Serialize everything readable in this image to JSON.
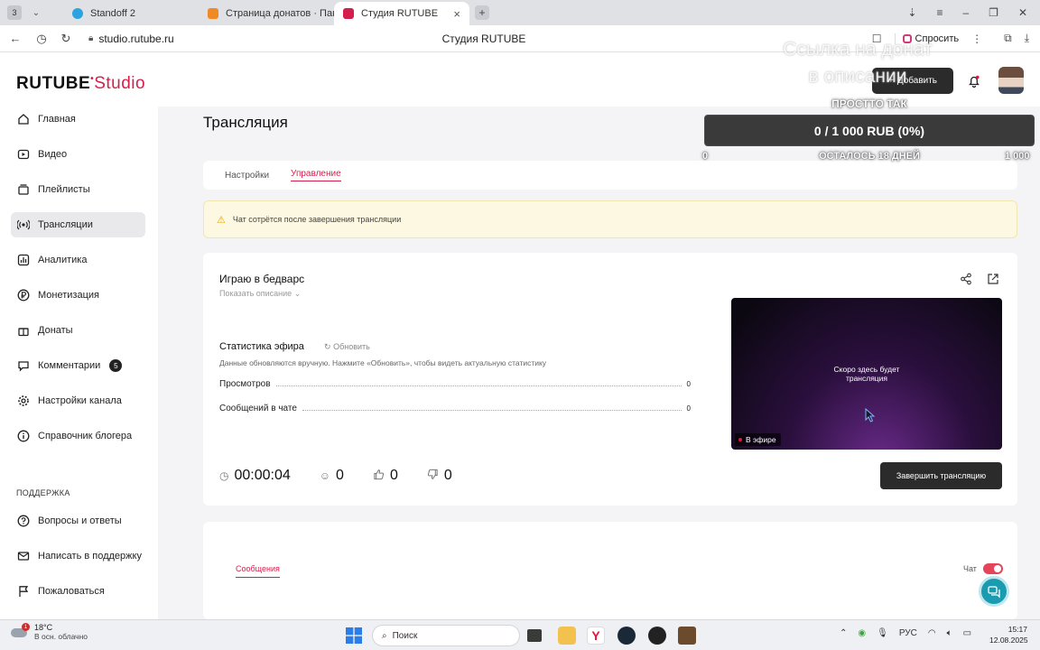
{
  "browser": {
    "tab_count": "3",
    "tabs": [
      {
        "label": "Standoff 2",
        "favicon_color": "#2aa3e0",
        "active": false
      },
      {
        "label": "Страница донатов · Панель",
        "favicon_color": "#f08a24",
        "active": false
      },
      {
        "label": "Студия RUTUBE",
        "favicon_color": "#d41f4c",
        "active": true
      }
    ],
    "url": "studio.rutube.ru",
    "page_title": "Студия RUTUBE",
    "ask_label": "Спросить"
  },
  "app": {
    "logo_brand": "RUTUBE",
    "logo_product": "Studio",
    "add_label": "Добавить",
    "menu": [
      {
        "label": "Главная",
        "icon": "home-icon"
      },
      {
        "label": "Видео",
        "icon": "video-icon"
      },
      {
        "label": "Плейлисты",
        "icon": "playlist-icon"
      },
      {
        "label": "Трансляции",
        "icon": "broadcast-icon",
        "active": true
      },
      {
        "label": "Аналитика",
        "icon": "analytics-icon"
      },
      {
        "label": "Монетизация",
        "icon": "ruble-icon"
      },
      {
        "label": "Донаты",
        "icon": "donate-icon"
      },
      {
        "label": "Комментарии",
        "icon": "comment-icon",
        "badge": "5"
      },
      {
        "label": "Настройки канала",
        "icon": "gear-icon"
      },
      {
        "label": "Справочник блогера",
        "icon": "info-icon"
      }
    ],
    "support_title": "ПОДДЕРЖКА",
    "support_menu": [
      {
        "label": "Вопросы и ответы",
        "icon": "help-icon"
      },
      {
        "label": "Написать в поддержку",
        "icon": "mail-icon"
      },
      {
        "label": "Пожаловаться",
        "icon": "flag-icon"
      }
    ]
  },
  "main": {
    "heading": "Трансляция",
    "tabs": [
      "Настройки",
      "Управление"
    ],
    "active_tab": "Управление",
    "warning": "Чат сотрётся после завершения трансляции",
    "stream": {
      "title": "Играю в бедварс",
      "show_description": "Показать описание",
      "stats_title": "Статистика эфира",
      "refresh_label": "Обновить",
      "stats_note": "Данные обновляются вручную. Нажмите «Обновить», чтобы видеть актуальную статистику",
      "rows": [
        {
          "label": "Просмотров",
          "value": "0"
        },
        {
          "label": "Сообщений в чате",
          "value": "0"
        }
      ],
      "duration": "00:00:04",
      "viewers": "0",
      "likes": "0",
      "dislikes": "0",
      "preview_text_1": "Скоро здесь будет",
      "preview_text_2": "трансляция",
      "live_label": "В эфире",
      "end_label": "Завершить трансляцию"
    },
    "chat": {
      "tab_label": "Сообщения",
      "chat_label": "Чат",
      "chat_enabled": true
    }
  },
  "overlay": {
    "title_line1": "Ссылка на донат",
    "title_line2": "в описании",
    "subtitle": "ПРОСТТО ТАК",
    "progress_text": "0 / 1 000 RUB (0%)",
    "progress_fraction": 0,
    "min_label": "0",
    "remaining_label": "ОСТАЛОСЬ 18 ДНЕЙ",
    "max_label": "1 000"
  },
  "taskbar": {
    "weather_badge": "1",
    "temp": "18°C",
    "condition": "В осн. облачно",
    "search_placeholder": "Поиск",
    "language": "РУС",
    "time": "15:17",
    "date": "12.08.2025"
  },
  "colors": {
    "brand": "#d41f4c",
    "dark_button": "#2b2b2b",
    "warning_bg": "#fdf8e1"
  }
}
